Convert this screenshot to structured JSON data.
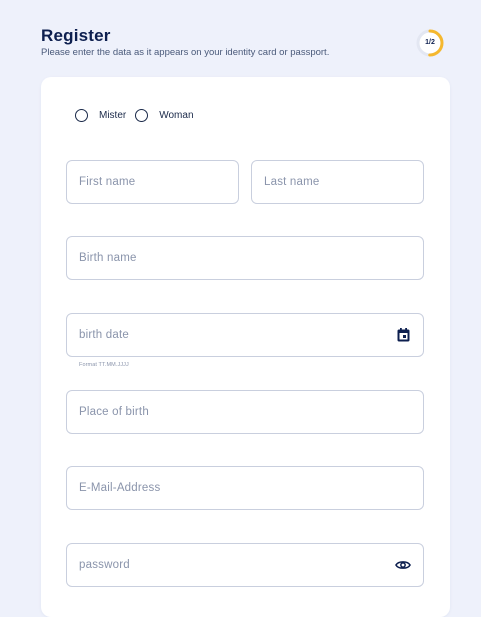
{
  "header": {
    "title": "Register",
    "subtitle": "Please enter the data as it appears on your identity card or passport.",
    "progress_label": "1/2",
    "progress_fraction": 0.5
  },
  "form": {
    "gender": {
      "options": [
        "Mister",
        "Woman"
      ]
    },
    "first_name": {
      "placeholder": "First name",
      "value": ""
    },
    "last_name": {
      "placeholder": "Last name",
      "value": ""
    },
    "birth_name": {
      "placeholder": "Birth name",
      "value": ""
    },
    "birth_date": {
      "placeholder": "birth date",
      "value": "",
      "hint": "Format TT.MM.JJJJ",
      "icon": "calendar-icon"
    },
    "place_of_birth": {
      "placeholder": "Place of birth",
      "value": ""
    },
    "email": {
      "placeholder": "E-Mail-Address",
      "value": ""
    },
    "password": {
      "placeholder": "password",
      "value": "",
      "icon": "eye-icon"
    }
  },
  "colors": {
    "background": "#eef1fb",
    "card": "#ffffff",
    "accent": "#f5b82e",
    "text_dark": "#0d1f4f",
    "border": "#c9cfde"
  }
}
